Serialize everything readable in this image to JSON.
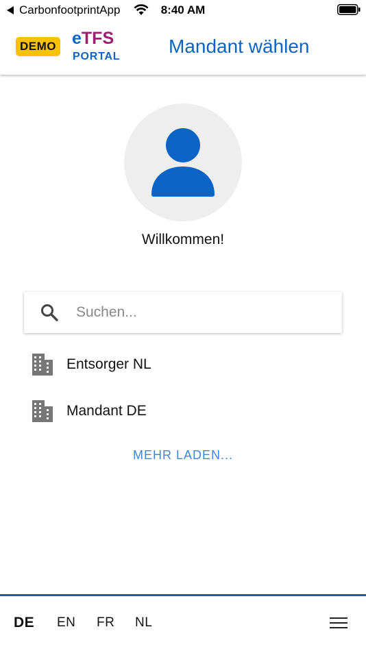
{
  "status_bar": {
    "back_app": "CarbonfootprintApp",
    "time": "8:40 AM"
  },
  "header": {
    "demo_badge": "DEMO",
    "brand_e": "e",
    "brand_rest": "TFS",
    "brand_sub": "PORTAL",
    "title": "Mandant wählen"
  },
  "welcome": "Willkommen!",
  "search": {
    "placeholder": "Suchen...",
    "value": ""
  },
  "list": {
    "items": [
      {
        "label": "Entsorger NL",
        "icon": "building-icon"
      },
      {
        "label": "Mandant DE",
        "icon": "building-icon"
      }
    ],
    "more_label": "MEHR LADEN..."
  },
  "footer": {
    "languages": [
      "DE",
      "EN",
      "FR",
      "NL"
    ],
    "active_language": "DE"
  },
  "colors": {
    "primary_blue": "#0b63c5",
    "brand_purple": "#9a1f6d",
    "demo_yellow": "#f9c200",
    "link_blue": "#3b86e0",
    "footer_line": "#1a5ea8"
  }
}
